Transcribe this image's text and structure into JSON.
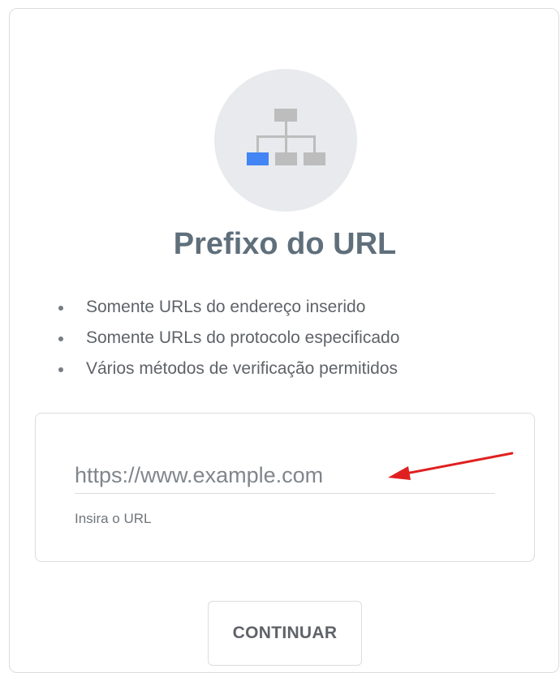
{
  "card": {
    "icon": "sitemap-hierarchy-icon",
    "title": "Prefixo do URL",
    "features": [
      "Somente URLs do endereço inserido",
      "Somente URLs do protocolo especificado",
      "Vários métodos de verificação permitidos"
    ],
    "url_input": {
      "value": "",
      "placeholder": "https://www.example.com",
      "helper": "Insira o URL"
    },
    "annotation": {
      "icon": "red-arrow-icon",
      "color": "#e02020"
    },
    "continue_label": "CONTINUAR"
  },
  "colors": {
    "accent": "#4285f4",
    "title": "#5f6f7b",
    "icon_gray": "#bdbdbd",
    "icon_bg": "#e8eaed"
  }
}
